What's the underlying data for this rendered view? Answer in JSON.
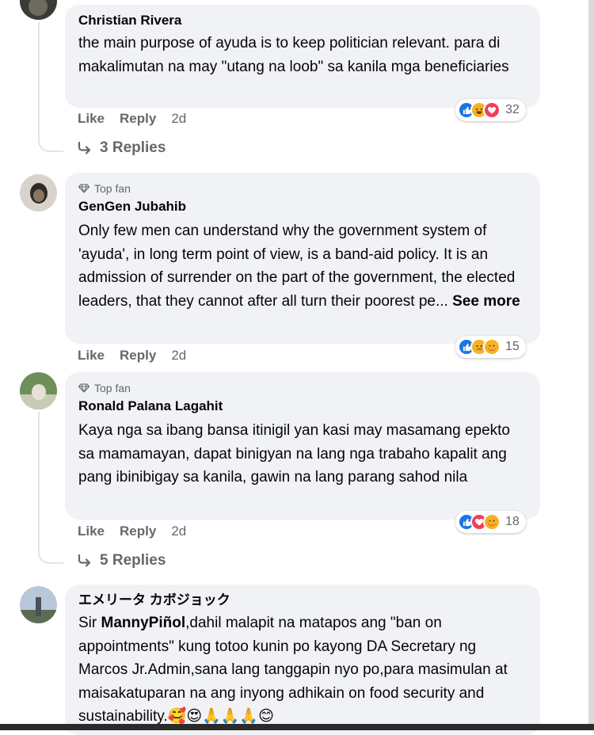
{
  "comments": [
    {
      "name": "Christian Rivera",
      "text": "the main purpose of ayuda is to keep politician relevant. para di makalimutan na may \"utang na loob\" sa kanila mga beneficiaries",
      "like": "Like",
      "reply": "Reply",
      "time": "2d",
      "reaction_count": "32",
      "reaction_icons": [
        "like",
        "haha",
        "love"
      ],
      "replies": "3 Replies"
    },
    {
      "badge": "Top fan",
      "name": "GenGen Jubahib",
      "text": "Only few men can understand why the government system of 'ayuda', in long term point of view, is a band-aid policy. It is an admission of surrender on the part of the government, the elected leaders, that they cannot after all turn their poorest pe...",
      "see_more": "See more",
      "like": "Like",
      "reply": "Reply",
      "time": "2d",
      "reaction_count": "15",
      "reaction_icons": [
        "like",
        "sad",
        "care"
      ]
    },
    {
      "badge": "Top fan",
      "name": "Ronald Palana Lagahit",
      "text": "Kaya nga sa ibang bansa itinigil yan kasi may masamang epekto sa mamamayan, dapat binigyan na lang nga trabaho kapalit ang pang ibinibigay sa kanila, gawin na lang parang sahod nila",
      "like": "Like",
      "reply": "Reply",
      "time": "2d",
      "reaction_count": "18",
      "reaction_icons": [
        "like",
        "love",
        "care"
      ],
      "replies": "5 Replies"
    },
    {
      "name": "エメリータ カボジョック",
      "text_prefix": "Sir ",
      "mention": "MannyPiñol",
      "text": ",dahil malapit na matapos ang \"ban on appointments\" kung totoo kunin po kayong DA Secretary ng Marcos Jr.Admin,sana lang tanggapin nyo po,para masimulan at maisakatuparan na ang inyong adhikain on food security and sustainability.",
      "emoji": "🥰😍🙏🙏🙏😊"
    }
  ],
  "colors": {
    "bubble": "#f0f2f5",
    "secondary_text": "#65676b",
    "like_blue": "#1b74e4",
    "love_red": "#f33e58",
    "haha_yellow": "#f7b125"
  }
}
